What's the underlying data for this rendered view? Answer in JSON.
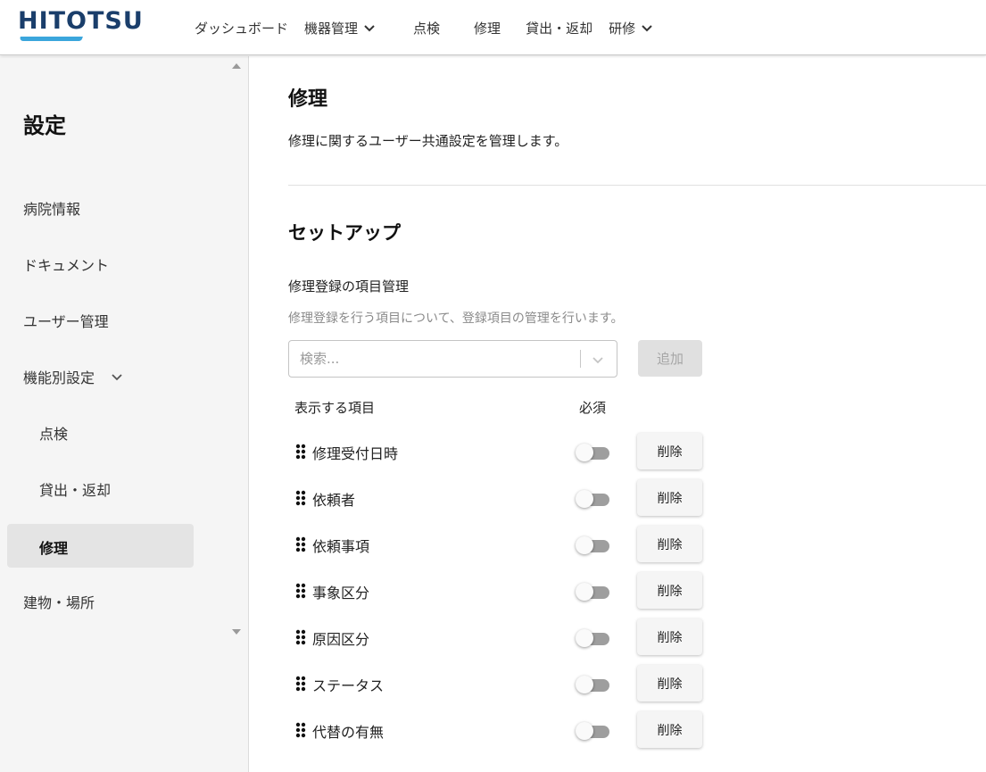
{
  "header": {
    "logo_text": "HITOTSU",
    "nav": [
      {
        "label": "ダッシュボード",
        "has_dropdown": false
      },
      {
        "label": "機器管理",
        "has_dropdown": true
      },
      {
        "label": "点検",
        "has_dropdown": false
      },
      {
        "label": "修理",
        "has_dropdown": false
      },
      {
        "label": "貸出・返却",
        "has_dropdown": false
      },
      {
        "label": "研修",
        "has_dropdown": true
      }
    ]
  },
  "sidebar": {
    "title": "設定",
    "items": [
      {
        "label": "病院情報"
      },
      {
        "label": "ドキュメント"
      },
      {
        "label": "ユーザー管理"
      },
      {
        "label": "機能別設定",
        "expanded": true
      },
      {
        "label": "点検",
        "sub": true
      },
      {
        "label": "貸出・返却",
        "sub": true
      },
      {
        "label": "修理",
        "sub": true,
        "active": true
      },
      {
        "label": "建物・場所"
      }
    ]
  },
  "main": {
    "title": "修理",
    "description": "修理に関するユーザー共通設定を管理します。",
    "section_title": "セットアップ",
    "subsection_title": "修理登録の項目管理",
    "subsection_description": "修理登録を行う項目について、登録項目の管理を行います。",
    "search": {
      "placeholder": "検索..."
    },
    "add_label": "追加",
    "columns": {
      "item": "表示する項目",
      "required": "必須"
    },
    "delete_label": "削除",
    "rows": [
      {
        "label": "修理受付日時",
        "required": false
      },
      {
        "label": "依頼者",
        "required": false
      },
      {
        "label": "依頼事項",
        "required": false
      },
      {
        "label": "事象区分",
        "required": false
      },
      {
        "label": "原因区分",
        "required": false
      },
      {
        "label": "ステータス",
        "required": false
      },
      {
        "label": "代替の有無",
        "required": false
      }
    ]
  },
  "colors": {
    "brand": "#1a3e6b",
    "accent": "#3ba6dc",
    "toggle_off": "#9e9e9e"
  }
}
